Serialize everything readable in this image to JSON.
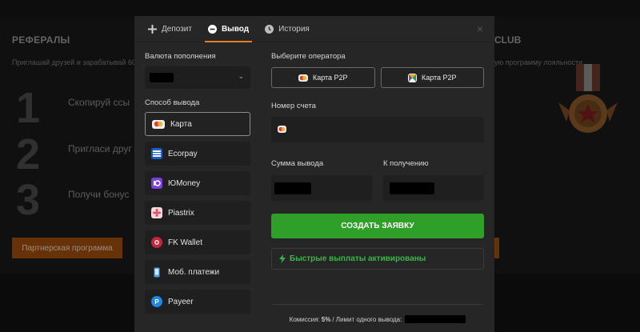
{
  "background": {
    "referrals_title": "РЕФЕРАЛЫ",
    "referrals_subtitle": "Приглашай друзей и зарабатывай 60",
    "steps": [
      {
        "num": "1",
        "text": "Скопируй ссы"
      },
      {
        "num": "2",
        "text": "Пригласи друг"
      },
      {
        "num": "3",
        "text": "Получи бонус"
      }
    ],
    "partner_button": "Партнерская программа",
    "club_title": "CLUB",
    "club_subtitle": "ую программу лояльности"
  },
  "modal": {
    "tabs": [
      {
        "label": "Депозит",
        "icon": "plus-icon"
      },
      {
        "label": "Вывод",
        "icon": "minus-circle-icon"
      },
      {
        "label": "История",
        "icon": "clock-icon"
      }
    ],
    "close_label": "×",
    "currency_label": "Валюта пополнения",
    "method_label": "Способ вывода",
    "methods": [
      {
        "label": "Карта",
        "icon": "visa-card-icon",
        "color": "#e3392e"
      },
      {
        "label": "Ecorpay",
        "icon": "ecorpay-icon",
        "color": "#1a5fd1"
      },
      {
        "label": "ЮMoney",
        "icon": "yoomoney-icon",
        "color": "#7b3fe4"
      },
      {
        "label": "Piastrix",
        "icon": "piastrix-icon",
        "color": "#e84a5f"
      },
      {
        "label": "FK Wallet",
        "icon": "fk-wallet-icon",
        "color": "#c4253a"
      },
      {
        "label": "Моб. платежи",
        "icon": "mobile-phone-icon",
        "color": "#4aa3df"
      },
      {
        "label": "Payeer",
        "icon": "payeer-icon",
        "color": "#1e88e5"
      }
    ],
    "operator_label": "Выберите оператора",
    "operators": [
      {
        "label": "Карта P2P",
        "icon": "card-p2p-icon"
      },
      {
        "label": "Карта P2P",
        "icon": "sbp-p2p-icon"
      }
    ],
    "account_label": "Номер счета",
    "amount_label": "Сумма вывода",
    "receive_label": "К получению",
    "create_button": "СОЗДАТЬ ЗАЯВКУ",
    "fast_payouts": "Быстрые выплаты активированы",
    "footer": {
      "commission_label": "Комиссия:",
      "commission_value": "5%",
      "limit_label": "/ Лимит одного вывода:"
    }
  },
  "colors": {
    "accent": "#e67e22",
    "green": "#2e9f27",
    "fast_green": "#39b54a",
    "orange_button": "#a04d0e"
  }
}
